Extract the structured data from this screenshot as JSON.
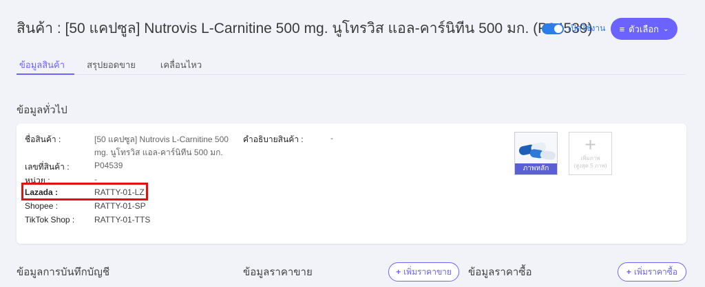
{
  "header": {
    "title": "สินค้า : [50 แคปซูล] Nutrovis L-Carnitine 500 mg. นูโทรวิส แอล-คาร์นิทีน 500 มก. (P04539)",
    "toggle_label": "เปิดใช้งาน",
    "options_label": "ตัวเลือก"
  },
  "tabs": [
    {
      "label": "ข้อมูลสินค้า"
    },
    {
      "label": "สรุปยอดขาย"
    },
    {
      "label": "เคลื่อนไหว"
    }
  ],
  "general": {
    "section_title": "ข้อมูลทั่วไป",
    "name_label": "ชื่อสินค้า :",
    "name_line1": "[50 แคปซูล] Nutrovis L-Carnitine 500",
    "name_line2": "mg. นูโทรวิส แอล-คาร์นิทีน 500 มก.",
    "code_label": "เลขที่สินค้า :",
    "code_value": "P04539",
    "unit_label": "หน่วย :",
    "unit_value": "-",
    "lazada_label": "Lazada :",
    "lazada_value": "RATTY-01-LZ",
    "shopee_label": "Shopee :",
    "shopee_value": "RATTY-01-SP",
    "tiktok_label": "TikTok Shop :",
    "tiktok_value": "RATTY-01-TTS",
    "desc_label": "คำอธิบายสินค้า :",
    "desc_value": "-",
    "main_image_tag": "ภาพหลัก",
    "add_image_line1": "เพิ่มภาพ",
    "add_image_line2": "(สูงสุด 5 ภาพ)"
  },
  "bottom": {
    "accounting_title": "ข้อมูลการบันทึกบัญชี",
    "sell_price_title": "ข้อมูลราคาขาย",
    "add_sell_price": "เพิ่มราคาขาย",
    "buy_price_title": "ข้อมูลราคาซื้อ",
    "add_buy_price": "เพิ่มราคาซื้อ"
  },
  "colors": {
    "accent": "#6c63ff",
    "toggle": "#2b7de9",
    "highlight": "#e01010"
  }
}
